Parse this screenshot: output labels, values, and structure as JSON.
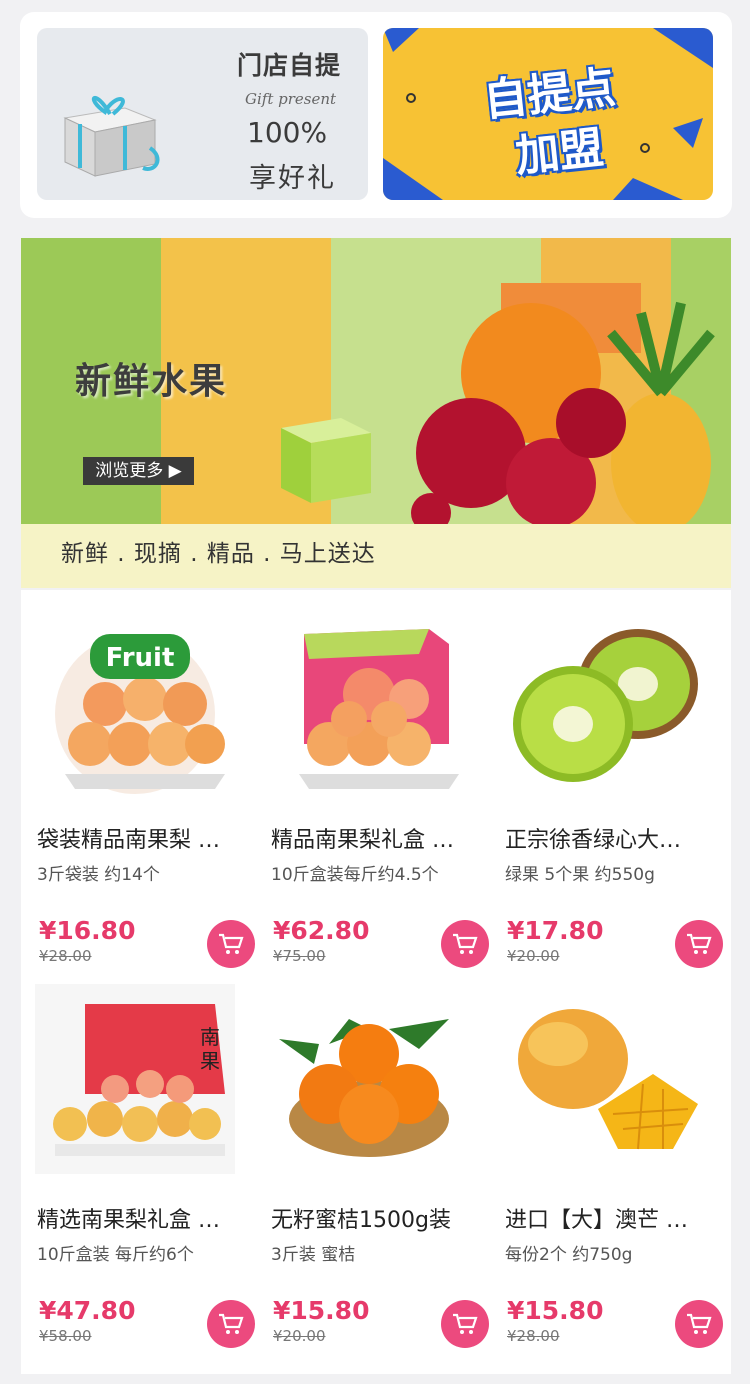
{
  "promo_pickup": {
    "title": "门店自提",
    "script": "Gift present",
    "percent": "100%",
    "enjoy": "享好礼"
  },
  "promo_join": {
    "line1": "自提点",
    "line2": "加盟"
  },
  "banner": {
    "title": "新鲜水果",
    "browse": "浏览更多 ▶",
    "slogan": "新鲜 . 现摘 . 精品 . 马上送达"
  },
  "products": [
    {
      "name": "袋装精品南果梨 …",
      "spec": "3斤袋装 约14个",
      "price": "¥16.80",
      "original": "¥28.00",
      "image": "bagged-pears"
    },
    {
      "name": "精品南果梨礼盒 …",
      "spec": "10斤盒装每斤约4.5个",
      "price": "¥62.80",
      "original": "¥75.00",
      "image": "pear-gift-box"
    },
    {
      "name": "正宗徐香绿心大…",
      "spec": "绿果 5个果 约550g",
      "price": "¥17.80",
      "original": "¥20.00",
      "image": "kiwi"
    },
    {
      "name": "精选南果梨礼盒 …",
      "spec": "10斤盒装 每斤约6个",
      "price": "¥47.80",
      "original": "¥58.00",
      "image": "pear-gift-box-2"
    },
    {
      "name": "无籽蜜桔1500g装",
      "spec": "3斤装 蜜桔",
      "price": "¥15.80",
      "original": "¥20.00",
      "image": "tangerines"
    },
    {
      "name": "进口【大】澳芒 …",
      "spec": "每份2个 约750g",
      "price": "¥15.80",
      "original": "¥28.00",
      "image": "mango"
    }
  ],
  "colors": {
    "price": "#e63a6a",
    "cart": "#ec4a7e",
    "join_bg": "#f7c234",
    "banner_green": "#b7d77a"
  },
  "icons": {
    "cart": "cart-icon"
  }
}
